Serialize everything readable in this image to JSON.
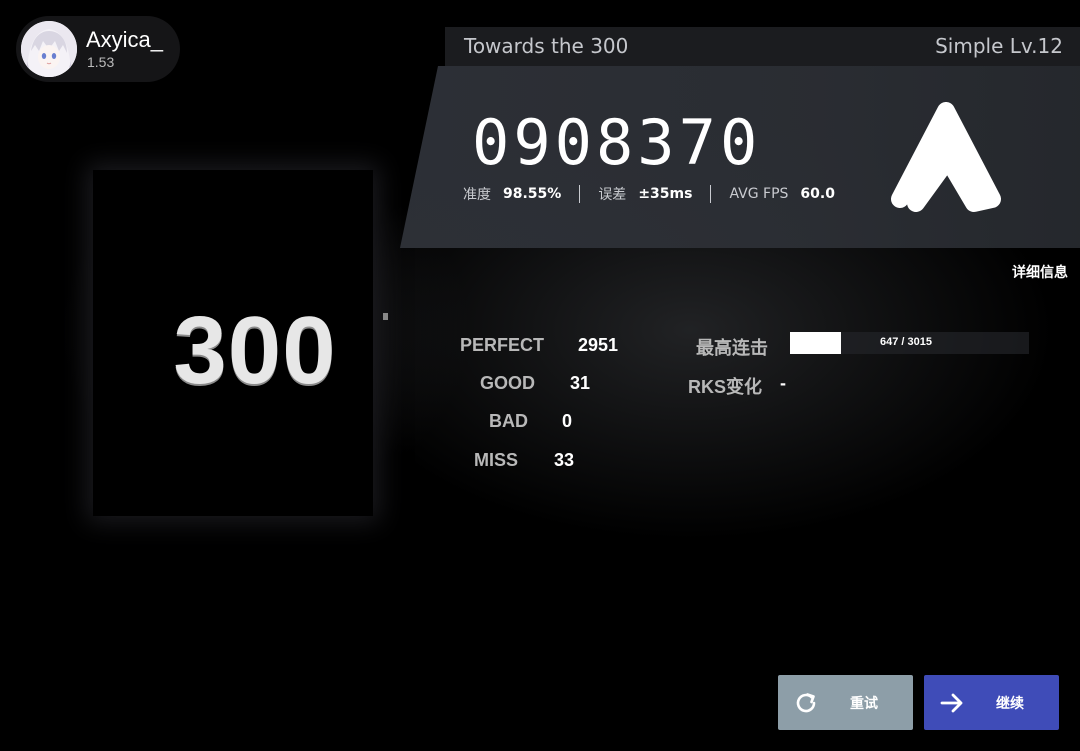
{
  "player": {
    "name": "Axyica_",
    "rks": "1.53"
  },
  "song": {
    "title": "Towards the 300",
    "level": "Simple Lv.12"
  },
  "result": {
    "score": "0908370",
    "rank_display": "300",
    "grade_icon": "letter-a-grade-logo",
    "accuracy_label": "准度",
    "accuracy_value": "98.55%",
    "error_label": "误差",
    "error_value": "±35ms",
    "fps_label": "AVG FPS",
    "fps_value": "60.0"
  },
  "detail_link": "详细信息",
  "judgements": {
    "perfect_label": "PERFECT",
    "perfect_value": "2951",
    "good_label": "GOOD",
    "good_value": "31",
    "bad_label": "BAD",
    "bad_value": "0",
    "miss_label": "MISS",
    "miss_value": "33"
  },
  "combo": {
    "label": "最高连击",
    "text": "647 / 3015",
    "current": 647,
    "total": 3015
  },
  "rks_change": {
    "label": "RKS变化",
    "value": "-"
  },
  "buttons": {
    "retry_label": "重试",
    "retry_icon": "refresh-icon",
    "continue_label": "继续",
    "continue_icon": "arrow-right-icon"
  },
  "colors": {
    "retry_button": "#8d9ea8",
    "continue_button": "#3f4cb8",
    "panel": "#30333a"
  }
}
